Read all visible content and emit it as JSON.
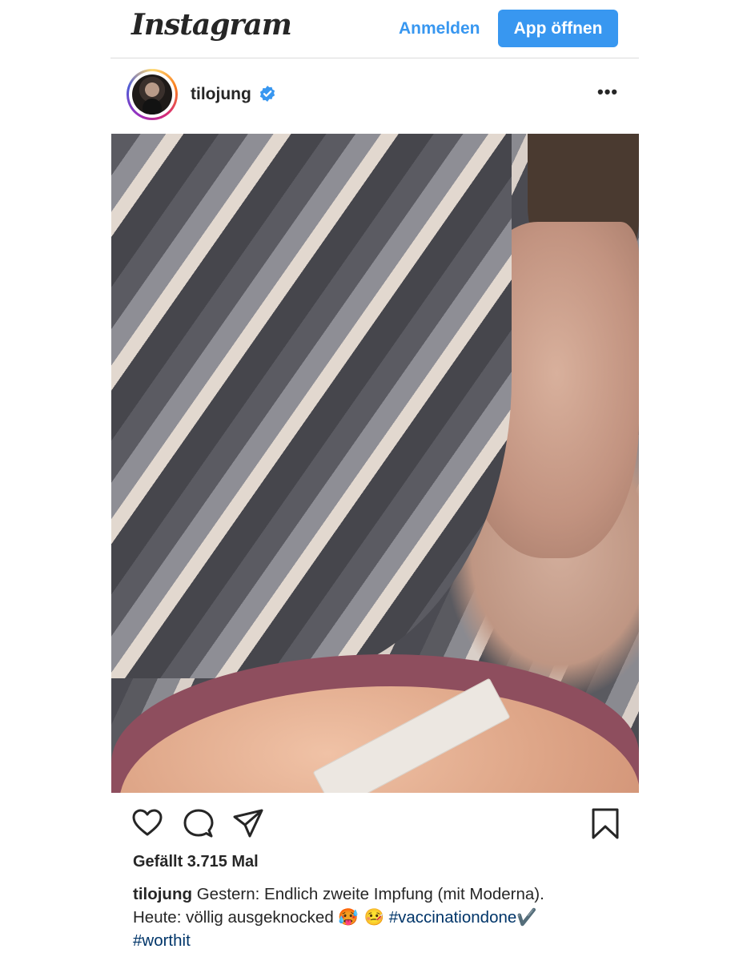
{
  "header": {
    "logo_text": "Instagram",
    "login_label": "Anmelden",
    "open_app_label": "App öffnen",
    "accent_color": "#3897f0"
  },
  "post": {
    "username": "tilojung",
    "verified_icon": "verified-badge-icon",
    "more_label": "•••",
    "image_alt": "Selfie im Bett mit Pflaster am Oberarm",
    "actions": [
      "heart-icon",
      "comment-icon",
      "share-icon",
      "bookmark-icon"
    ],
    "likes_text": "Gefällt 3.715 Mal",
    "caption": {
      "user": "tilojung",
      "line1_text": "Gestern: Endlich zweite Impfung (mit Moderna).",
      "line2_text": "Heute: völlig ausgeknocked",
      "emojis": "🥵 🤒",
      "hashtag1": "#vaccinationdone",
      "checkmark": "✔️",
      "hashtag2": "#worthit"
    }
  }
}
